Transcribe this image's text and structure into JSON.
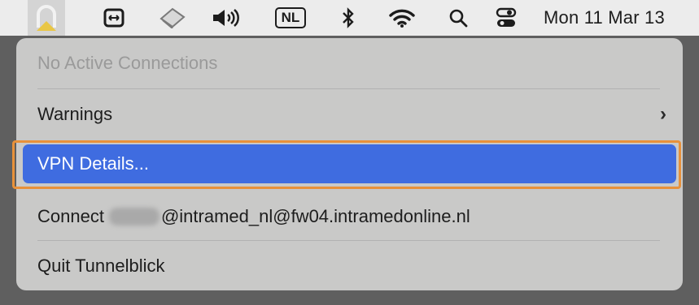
{
  "menubar": {
    "clock": "Mon 11 Mar 13",
    "keyboard_layout": "NL",
    "icons": [
      "tunnelblick-icon",
      "screen-mirror-icon",
      "scanner-icon",
      "volume-icon",
      "keyboard-layout-icon",
      "bluetooth-icon",
      "wifi-icon",
      "spotlight-search-icon",
      "control-center-icon"
    ]
  },
  "menu": {
    "status": "No Active Connections",
    "warnings": "Warnings",
    "vpn_details": "VPN Details...",
    "connect_prefix": "Connect ",
    "connect_suffix": "@intramed_nl@fw04.intramedonline.nl",
    "quit": "Quit Tunnelblick"
  },
  "colors": {
    "highlight": "#3f6ce0",
    "annotation_frame": "#e8913a",
    "tunnelblick_icon": "#e9c645"
  }
}
